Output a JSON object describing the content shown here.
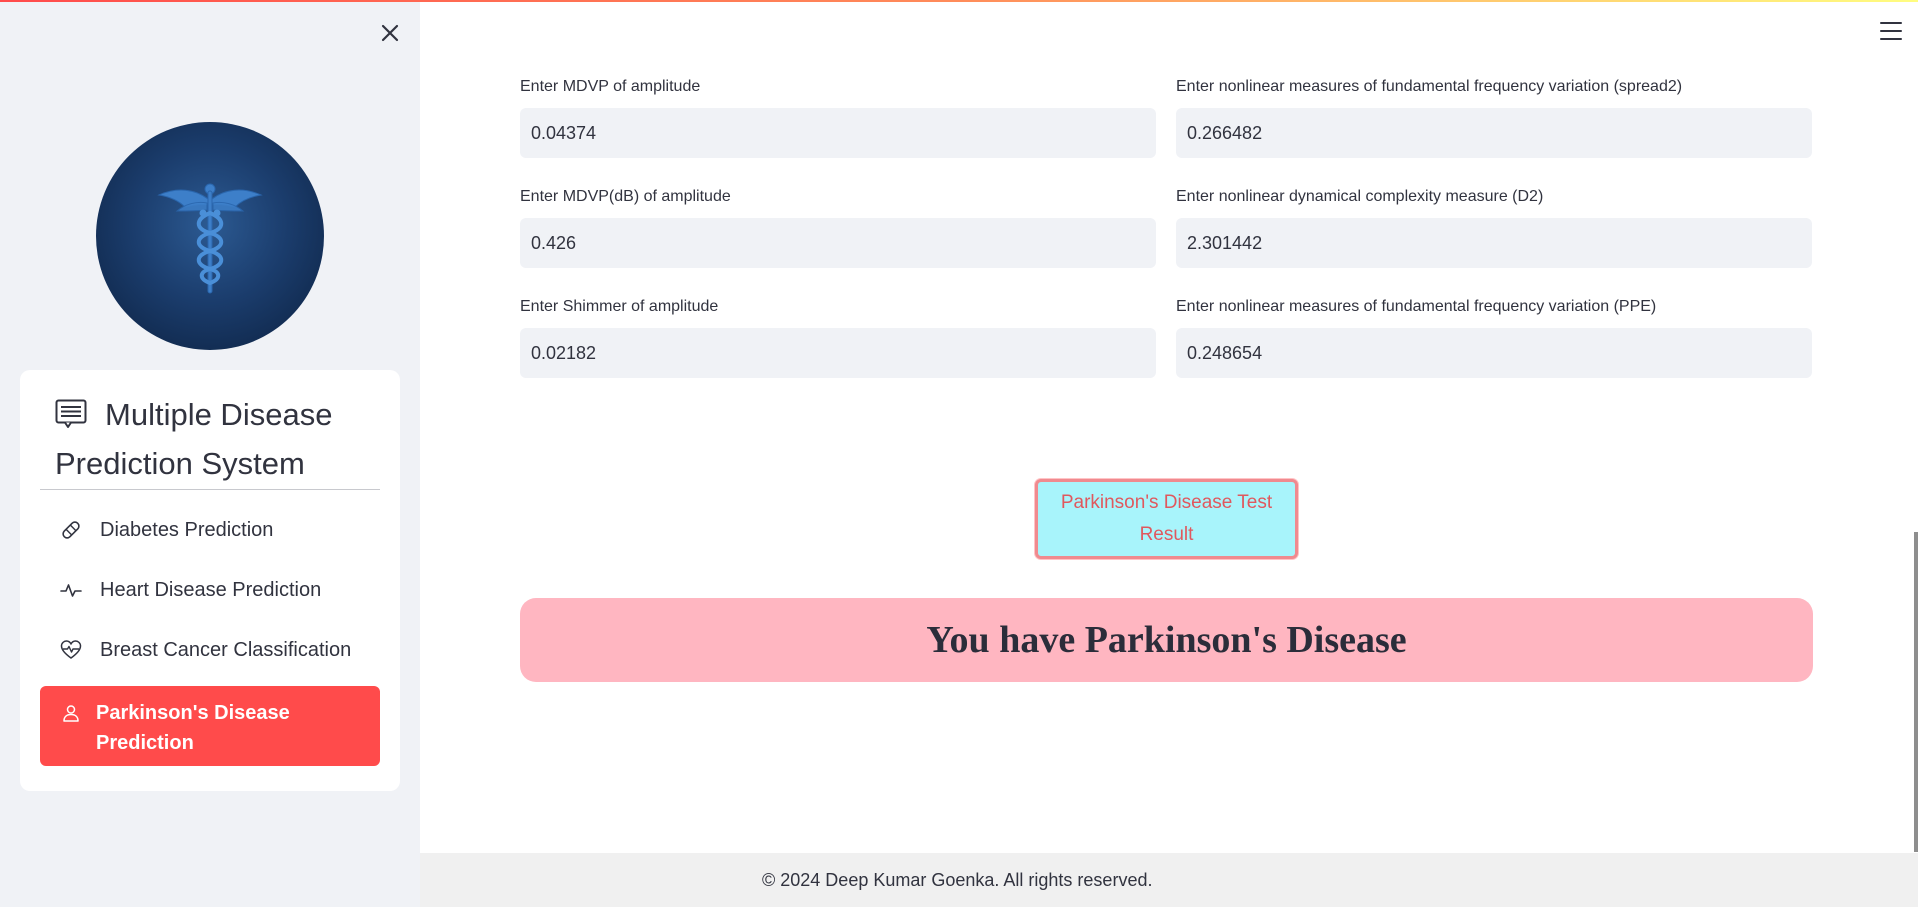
{
  "sidebar": {
    "close_icon": "close-icon",
    "logo_icon": "caduceus-icon",
    "menu_title": "Multiple Disease Prediction System",
    "menu_title_icon": "chat-list-icon",
    "items": [
      {
        "label": "Diabetes Prediction",
        "icon": "bandage-icon"
      },
      {
        "label": "Heart Disease Prediction",
        "icon": "pulse-icon"
      },
      {
        "label": "Breast Cancer Classification",
        "icon": "heart-pulse-icon"
      },
      {
        "label": "Parkinson's Disease Prediction",
        "icon": "person-icon",
        "active": true
      }
    ],
    "accent_color": "#ff4b4b"
  },
  "header": {
    "menu_icon": "hamburger-icon"
  },
  "form": {
    "fields": [
      {
        "label": "Enter MDVP of amplitude",
        "value": "0.04374"
      },
      {
        "label": "Enter nonlinear measures of fundamental frequency variation (spread2)",
        "value": "0.266482"
      },
      {
        "label": "Enter MDVP(dB) of amplitude",
        "value": "0.426"
      },
      {
        "label": "Enter nonlinear dynamical complexity measure (D2)",
        "value": "2.301442"
      },
      {
        "label": "Enter Shimmer of amplitude",
        "value": "0.02182"
      },
      {
        "label": "Enter nonlinear measures of fundamental frequency variation (PPE)",
        "value": "0.248654"
      }
    ]
  },
  "result_button": {
    "label": "Parkinson's Disease Test Result",
    "background": "#a8f4fb",
    "text_color": "#e0585e"
  },
  "result": {
    "text": "You have Parkinson's Disease",
    "background": "#ffb6c1"
  },
  "footer": {
    "text": "© 2024 Deep Kumar Goenka. All rights reserved."
  }
}
